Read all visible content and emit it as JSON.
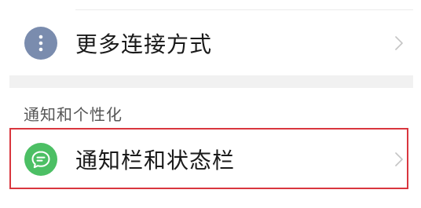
{
  "settings_list": {
    "more_connections": {
      "label": "更多连接方式",
      "icon": "more-vertical-icon",
      "icon_color": "#7a8cae"
    },
    "section_header": "通知和个性化",
    "notifications_status_bar": {
      "label": "通知栏和状态栏",
      "icon": "message-bubble-icon",
      "icon_color": "#4cbf64",
      "highlighted": true,
      "highlight_color": "#d9363e"
    }
  }
}
